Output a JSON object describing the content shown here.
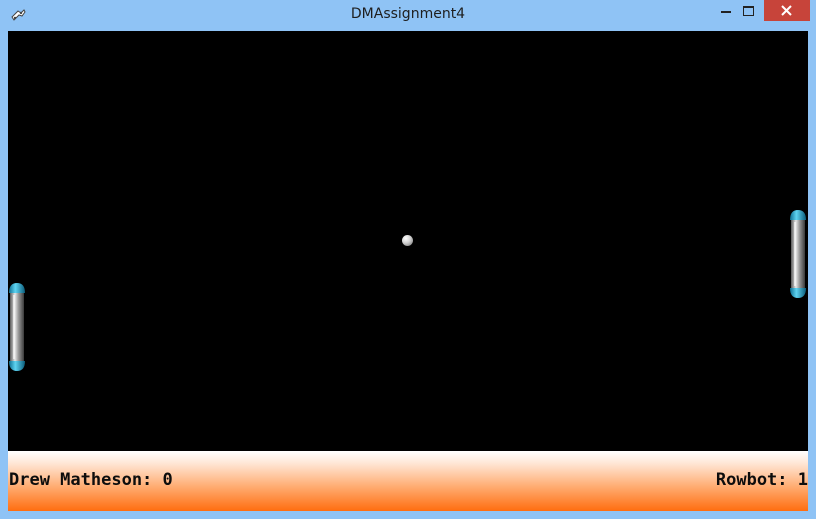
{
  "window": {
    "title": "DMAssignment4",
    "icons": {
      "app": "game-controller-icon",
      "minimize": "minimize-icon",
      "maximize": "maximize-icon",
      "close": "close-icon"
    },
    "colors": {
      "frame": "#8fc3f5",
      "close_button": "#c7443a"
    }
  },
  "game": {
    "playfield_color": "#000000",
    "paddle_color": "#1ba0c8",
    "ball_color": "#d0d0d0"
  },
  "scoreboard": {
    "player1": {
      "label": "Drew Matheson: 0",
      "name": "Drew Matheson",
      "score": 0
    },
    "player2": {
      "label": "Rowbot: 1",
      "name": "Rowbot",
      "score": 1
    },
    "gradient_colors": [
      "#ffffff",
      "#ff6d10"
    ]
  }
}
